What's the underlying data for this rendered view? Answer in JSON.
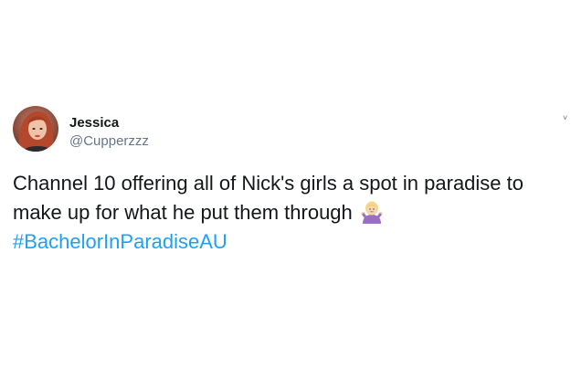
{
  "tweet": {
    "author": {
      "display_name": "Jessica",
      "handle": "@Cupperzzz"
    },
    "text_line1": "Channel 10 offering all of Nick's girls a spot in paradise to",
    "text_line2": "make up for what he put them through",
    "emoji_name": "person-shrugging-emoji",
    "hashtag": "#BachelorInParadiseAU",
    "caret_icon": "chevron-down-icon",
    "caret_glyph": "˅",
    "colors": {
      "text": "#14171a",
      "secondary": "#657786",
      "link": "#1da1f2"
    }
  }
}
